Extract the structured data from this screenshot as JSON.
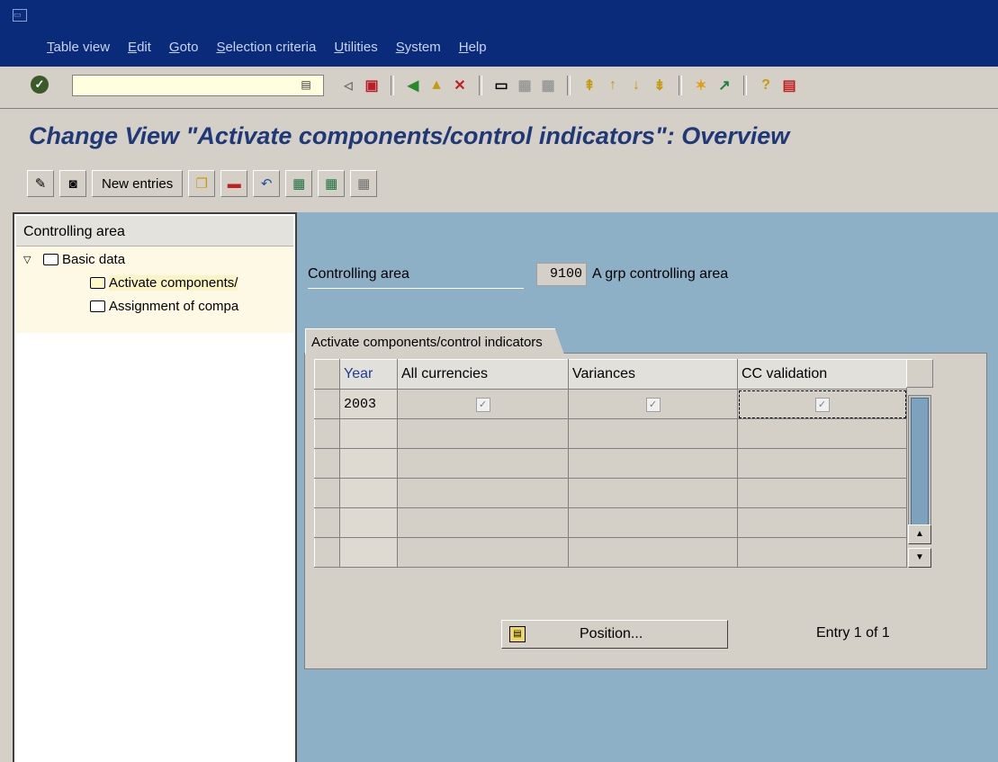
{
  "menu": {
    "items": [
      "Table view",
      "Edit",
      "Goto",
      "Selection criteria",
      "Utilities",
      "System",
      "Help"
    ]
  },
  "toolbar": {
    "command_value": "",
    "icons": [
      "enter-icon",
      "back-icon",
      "save-icon",
      "back-nav-icon",
      "exit-icon",
      "cancel-icon",
      "print-icon",
      "find-icon",
      "find-next-icon",
      "first-page-icon",
      "prev-page-icon",
      "next-page-icon",
      "last-page-icon",
      "new-session-icon",
      "shortcut-icon",
      "help-icon",
      "layout-icon"
    ]
  },
  "screen": {
    "title": "Change View \"Activate components/control indicators\": Overview"
  },
  "app_toolbar": {
    "new_entries_label": "New entries"
  },
  "nav": {
    "header": "Controlling area",
    "tree": [
      {
        "label": "Basic data",
        "level": 0,
        "expanded": true
      },
      {
        "label": "Activate components/",
        "level": 1,
        "selected": true
      },
      {
        "label": "Assignment of compa",
        "level": 1,
        "selected": false
      }
    ]
  },
  "main": {
    "controlling_area_label": "Controlling area",
    "controlling_area_value": "9100",
    "controlling_area_text": "A grp controlling area",
    "table_caption": "Activate components/control indicators",
    "columns": [
      "Year",
      "All currencies",
      "Variances",
      "CC validation"
    ],
    "rows": [
      {
        "year": "2003",
        "all_currencies": true,
        "variances": true,
        "cc_validation": true
      }
    ],
    "position_label": "Position...",
    "entry_text": "Entry 1 of 1"
  },
  "colors": {
    "title_bar": "#0a2a7a",
    "screen_title": "#1f3878",
    "content_bg": "#8eb0c6"
  }
}
